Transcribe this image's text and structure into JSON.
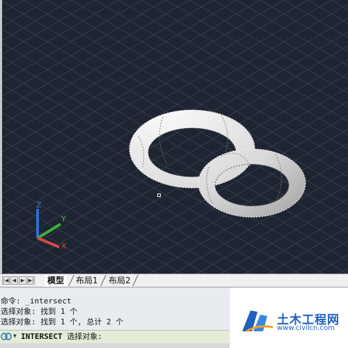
{
  "viewport": {
    "background": "#1e2431",
    "grid_color": "#3b4252",
    "object": "two-intersecting-torus-rings",
    "ucs_labels": {
      "z": "Z",
      "y": "Y",
      "x": "X"
    },
    "axis_colors": {
      "z": "#2f6fd3",
      "y": "#3fae3f",
      "x": "#d24a4a"
    }
  },
  "layout_tabs": {
    "nav_icons": [
      "first-tab-icon",
      "prev-tab-icon",
      "next-tab-icon",
      "last-tab-icon"
    ],
    "tabs": [
      {
        "label": "模型",
        "active": true
      },
      {
        "label": "布局1",
        "active": false
      },
      {
        "label": "布局2",
        "active": false
      }
    ]
  },
  "command_history": [
    "命令: _intersect",
    "选择对象: 找到 1 个",
    "选择对象: 找到 1 个, 总计 2 个"
  ],
  "command_line": {
    "command": "INTERSECT",
    "prompt": "选择对象:"
  },
  "watermark": {
    "title": "土木工程网",
    "url": "www.civilcn.com"
  }
}
